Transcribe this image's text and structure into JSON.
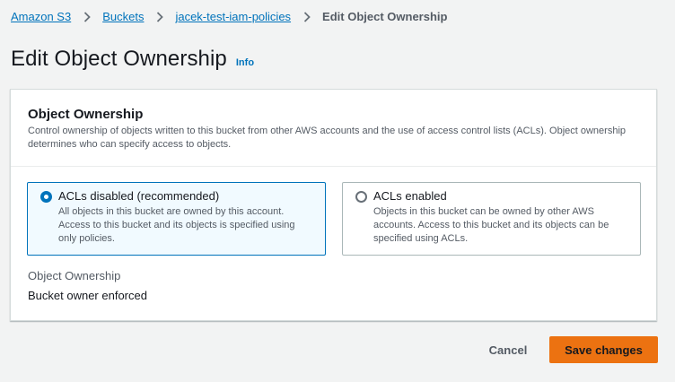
{
  "breadcrumb": {
    "items": [
      "Amazon S3",
      "Buckets",
      "jacek-test-iam-policies"
    ],
    "current": "Edit Object Ownership",
    "separator_icon": "chevron-right-icon"
  },
  "header": {
    "title": "Edit Object Ownership",
    "info_label": "Info"
  },
  "panel": {
    "heading": "Object Ownership",
    "description_line1": "Control ownership of objects written to this bucket from other AWS accounts and the use of access control lists (ACLs). Object ownership",
    "description_line2": "determines who can specify access to objects.",
    "options": [
      {
        "title": "ACLs disabled (recommended)",
        "lines": [
          "All objects in this bucket are owned by this account.",
          "Access to this bucket and its objects is specified using",
          "only policies."
        ],
        "selected": true
      },
      {
        "title": "ACLs enabled",
        "lines": [
          "Objects in this bucket can be owned by other AWS",
          "accounts. Access to this bucket and its objects can be",
          "specified using ACLs."
        ],
        "selected": false
      }
    ],
    "field_label": "Object Ownership",
    "field_value": "Bucket owner enforced"
  },
  "actions": {
    "cancel_label": "Cancel",
    "save_label": "Save changes"
  },
  "colors": {
    "link": "#0073bb",
    "primary_button": "#ec7211",
    "selected_tile_bg": "#f1faff",
    "page_bg": "#f2f3f3"
  }
}
